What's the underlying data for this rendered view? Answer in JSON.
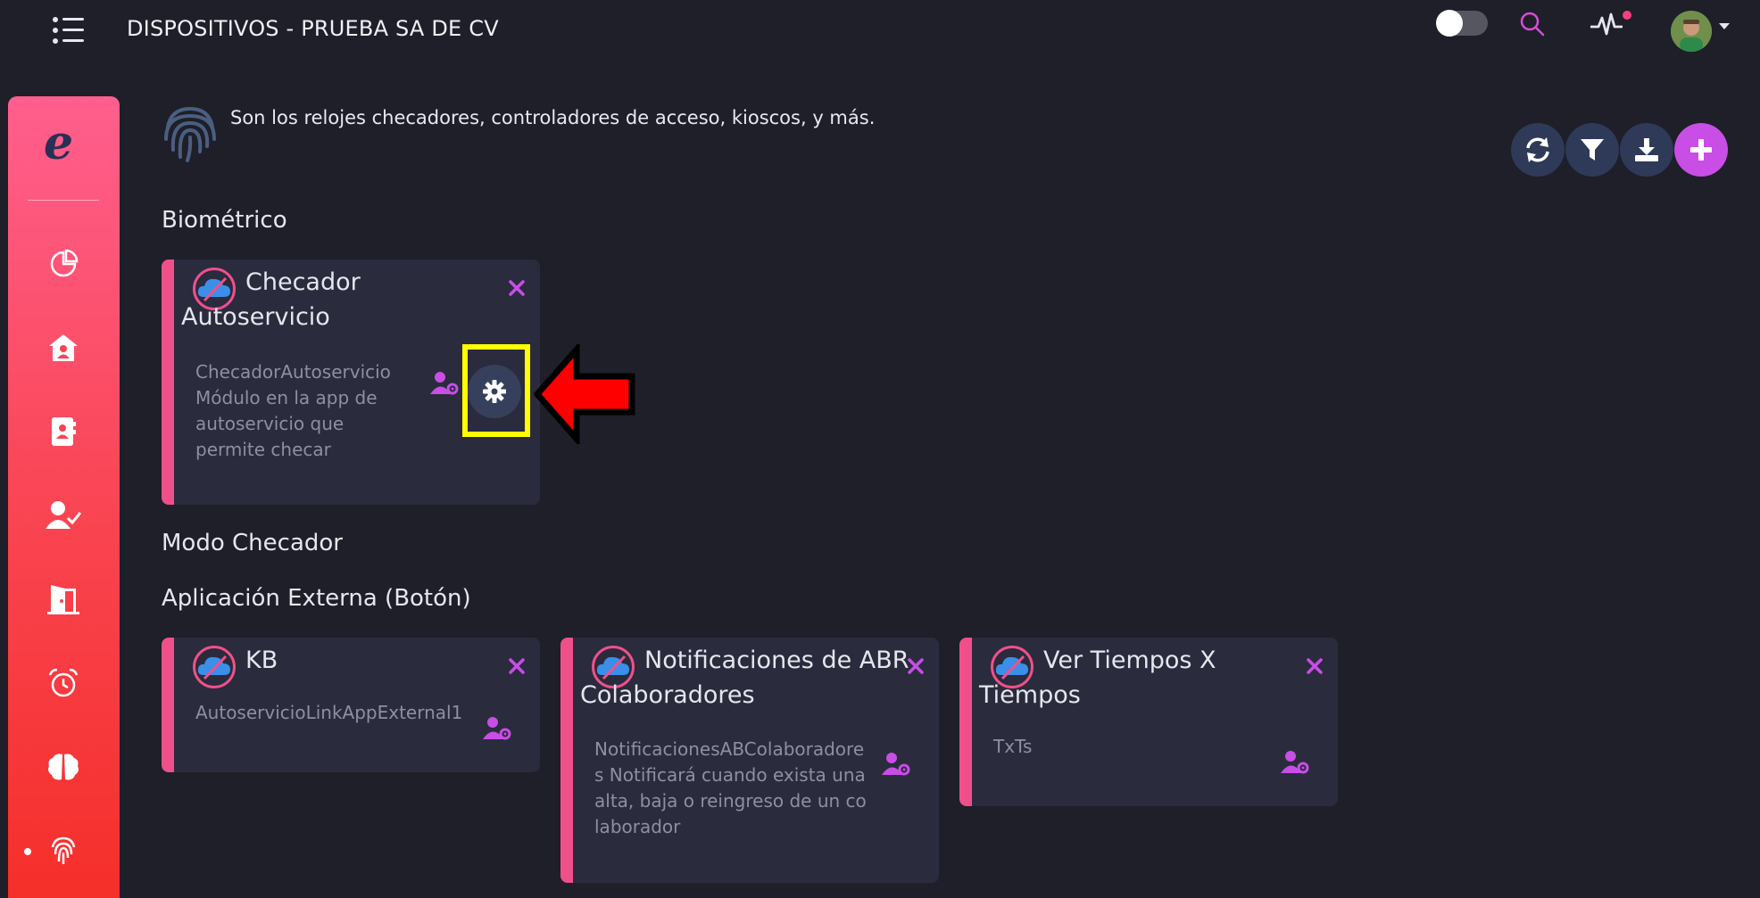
{
  "header": {
    "title": "DISPOSITIVOS - PRUEBA SA DE CV"
  },
  "description": "Son los relojes checadores, controladores de acceso, kioscos, y más.",
  "sections": [
    {
      "title": "Biométrico",
      "cards": [
        {
          "title": "Checador Autoservicio",
          "description": "ChecadorAutoservicio Módulo en la app de autoservicio que permite checar"
        }
      ]
    },
    {
      "title": "Modo Checador",
      "cards": []
    },
    {
      "title": "Aplicación Externa (Botón)",
      "cards": [
        {
          "title": "KB",
          "description": "AutoservicioLinkAppExternal1"
        },
        {
          "title": "Notificaciones de ABR Colaboradores",
          "description": "NotificacionesABColaboradores Notificará cuando exista una alta, baja o reingreso de un colaborador"
        },
        {
          "title": "Ver Tiempos X Tiempos",
          "description": "TxTs"
        }
      ]
    }
  ],
  "colors": {
    "background": "#1e1f29",
    "card": "#2a2b3d",
    "accent_pink": "#f0508a",
    "accent_purple": "#c84ee6",
    "highlight": "#ffff00",
    "arrow": "#ff0000"
  },
  "icons": {
    "menu": "list-menu-icon",
    "search": "search-icon",
    "activity": "pulse-icon",
    "refresh": "refresh-icon",
    "filter": "filter-icon",
    "download": "download-icon",
    "add": "plus-icon",
    "device": "fingerprint-icon",
    "status": "cloud-offline-icon"
  }
}
